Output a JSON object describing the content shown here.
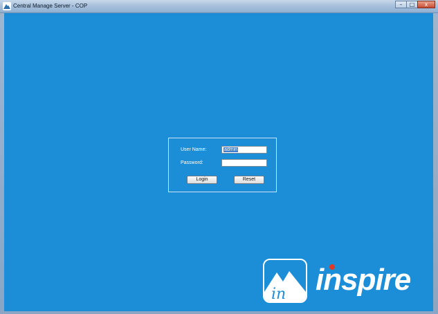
{
  "window": {
    "title": "Central Manage Server - COP",
    "controls": {
      "minimize": "–",
      "maximize": "□",
      "close": "x"
    }
  },
  "login": {
    "username_label": "User Name:",
    "username_value": "admin",
    "password_label": "Password:",
    "password_value": "",
    "login_button": "Login",
    "reset_button": "Reset"
  },
  "brand": {
    "logo_text": "inspire",
    "badge_text": "in",
    "background_color": "#1c8ed8",
    "accent_color": "#e0382b"
  }
}
